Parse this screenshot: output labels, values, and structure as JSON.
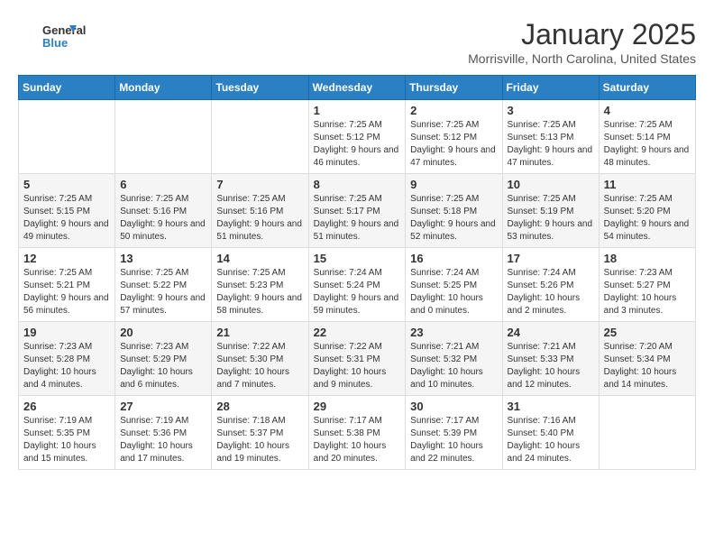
{
  "header": {
    "logo_text_general": "General",
    "logo_text_blue": "Blue",
    "month_year": "January 2025",
    "location": "Morrisville, North Carolina, United States"
  },
  "days_of_week": [
    "Sunday",
    "Monday",
    "Tuesday",
    "Wednesday",
    "Thursday",
    "Friday",
    "Saturday"
  ],
  "weeks": [
    {
      "cells": [
        {
          "day": "",
          "text": ""
        },
        {
          "day": "",
          "text": ""
        },
        {
          "day": "",
          "text": ""
        },
        {
          "day": "1",
          "text": "Sunrise: 7:25 AM\nSunset: 5:12 PM\nDaylight: 9 hours and 46 minutes."
        },
        {
          "day": "2",
          "text": "Sunrise: 7:25 AM\nSunset: 5:12 PM\nDaylight: 9 hours and 47 minutes."
        },
        {
          "day": "3",
          "text": "Sunrise: 7:25 AM\nSunset: 5:13 PM\nDaylight: 9 hours and 47 minutes."
        },
        {
          "day": "4",
          "text": "Sunrise: 7:25 AM\nSunset: 5:14 PM\nDaylight: 9 hours and 48 minutes."
        }
      ]
    },
    {
      "cells": [
        {
          "day": "5",
          "text": "Sunrise: 7:25 AM\nSunset: 5:15 PM\nDaylight: 9 hours and 49 minutes."
        },
        {
          "day": "6",
          "text": "Sunrise: 7:25 AM\nSunset: 5:16 PM\nDaylight: 9 hours and 50 minutes."
        },
        {
          "day": "7",
          "text": "Sunrise: 7:25 AM\nSunset: 5:16 PM\nDaylight: 9 hours and 51 minutes."
        },
        {
          "day": "8",
          "text": "Sunrise: 7:25 AM\nSunset: 5:17 PM\nDaylight: 9 hours and 51 minutes."
        },
        {
          "day": "9",
          "text": "Sunrise: 7:25 AM\nSunset: 5:18 PM\nDaylight: 9 hours and 52 minutes."
        },
        {
          "day": "10",
          "text": "Sunrise: 7:25 AM\nSunset: 5:19 PM\nDaylight: 9 hours and 53 minutes."
        },
        {
          "day": "11",
          "text": "Sunrise: 7:25 AM\nSunset: 5:20 PM\nDaylight: 9 hours and 54 minutes."
        }
      ]
    },
    {
      "cells": [
        {
          "day": "12",
          "text": "Sunrise: 7:25 AM\nSunset: 5:21 PM\nDaylight: 9 hours and 56 minutes."
        },
        {
          "day": "13",
          "text": "Sunrise: 7:25 AM\nSunset: 5:22 PM\nDaylight: 9 hours and 57 minutes."
        },
        {
          "day": "14",
          "text": "Sunrise: 7:25 AM\nSunset: 5:23 PM\nDaylight: 9 hours and 58 minutes."
        },
        {
          "day": "15",
          "text": "Sunrise: 7:24 AM\nSunset: 5:24 PM\nDaylight: 9 hours and 59 minutes."
        },
        {
          "day": "16",
          "text": "Sunrise: 7:24 AM\nSunset: 5:25 PM\nDaylight: 10 hours and 0 minutes."
        },
        {
          "day": "17",
          "text": "Sunrise: 7:24 AM\nSunset: 5:26 PM\nDaylight: 10 hours and 2 minutes."
        },
        {
          "day": "18",
          "text": "Sunrise: 7:23 AM\nSunset: 5:27 PM\nDaylight: 10 hours and 3 minutes."
        }
      ]
    },
    {
      "cells": [
        {
          "day": "19",
          "text": "Sunrise: 7:23 AM\nSunset: 5:28 PM\nDaylight: 10 hours and 4 minutes."
        },
        {
          "day": "20",
          "text": "Sunrise: 7:23 AM\nSunset: 5:29 PM\nDaylight: 10 hours and 6 minutes."
        },
        {
          "day": "21",
          "text": "Sunrise: 7:22 AM\nSunset: 5:30 PM\nDaylight: 10 hours and 7 minutes."
        },
        {
          "day": "22",
          "text": "Sunrise: 7:22 AM\nSunset: 5:31 PM\nDaylight: 10 hours and 9 minutes."
        },
        {
          "day": "23",
          "text": "Sunrise: 7:21 AM\nSunset: 5:32 PM\nDaylight: 10 hours and 10 minutes."
        },
        {
          "day": "24",
          "text": "Sunrise: 7:21 AM\nSunset: 5:33 PM\nDaylight: 10 hours and 12 minutes."
        },
        {
          "day": "25",
          "text": "Sunrise: 7:20 AM\nSunset: 5:34 PM\nDaylight: 10 hours and 14 minutes."
        }
      ]
    },
    {
      "cells": [
        {
          "day": "26",
          "text": "Sunrise: 7:19 AM\nSunset: 5:35 PM\nDaylight: 10 hours and 15 minutes."
        },
        {
          "day": "27",
          "text": "Sunrise: 7:19 AM\nSunset: 5:36 PM\nDaylight: 10 hours and 17 minutes."
        },
        {
          "day": "28",
          "text": "Sunrise: 7:18 AM\nSunset: 5:37 PM\nDaylight: 10 hours and 19 minutes."
        },
        {
          "day": "29",
          "text": "Sunrise: 7:17 AM\nSunset: 5:38 PM\nDaylight: 10 hours and 20 minutes."
        },
        {
          "day": "30",
          "text": "Sunrise: 7:17 AM\nSunset: 5:39 PM\nDaylight: 10 hours and 22 minutes."
        },
        {
          "day": "31",
          "text": "Sunrise: 7:16 AM\nSunset: 5:40 PM\nDaylight: 10 hours and 24 minutes."
        },
        {
          "day": "",
          "text": ""
        }
      ]
    }
  ]
}
